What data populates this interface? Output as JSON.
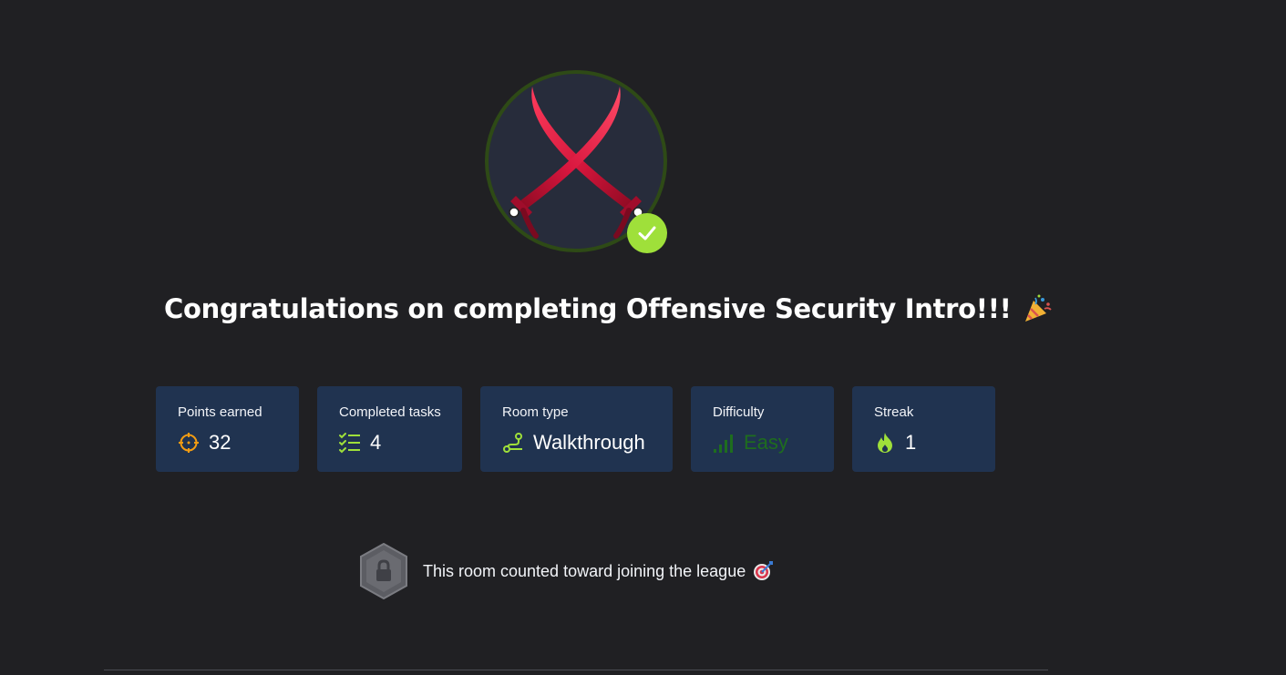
{
  "badge": {
    "icon": "crossed-swords-icon",
    "completed_icon": "check-icon",
    "ring_color": "#2e4a16",
    "check_color": "#9fe03a"
  },
  "title": {
    "text": "Congratulations on completing Offensive Security Intro!!!",
    "emoji_icon": "party-popper-icon"
  },
  "stats": [
    {
      "label": "Points earned",
      "value": "32",
      "icon": "crosshair-icon"
    },
    {
      "label": "Completed tasks",
      "value": "4",
      "icon": "checklist-icon"
    },
    {
      "label": "Room type",
      "value": "Walkthrough",
      "icon": "route-icon"
    },
    {
      "label": "Difficulty",
      "value": "Easy",
      "icon": "signal-bars-icon"
    },
    {
      "label": "Streak",
      "value": "1",
      "icon": "flame-icon"
    }
  ],
  "league": {
    "text": "This room counted toward joining the league",
    "icon": "locked-league-icon",
    "emoji_icon": "dart-target-icon"
  },
  "colors": {
    "background": "#202023",
    "card": "#203350",
    "accent_green": "#9fe03a",
    "accent_orange": "#f39c12",
    "easy_green": "#1e6d1e"
  }
}
